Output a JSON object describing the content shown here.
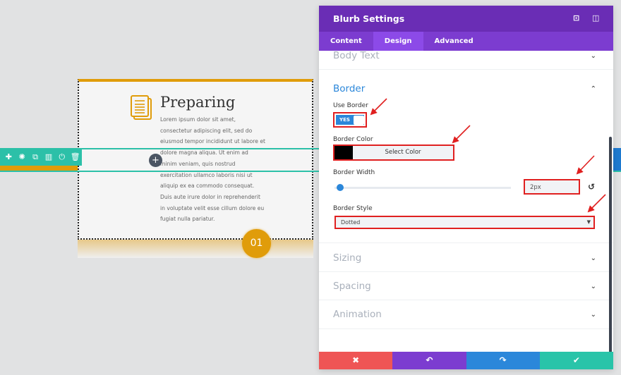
{
  "canvas": {
    "module_title": "Preparing",
    "module_body": "Lorem ipsum dolor sit amet, consectetur adipiscing elit, sed do eiusmod tempor incididunt ut labore et dolore magna aliqua. Ut enim ad minim veniam, quis nostrud exercitation ullamco laboris nisi ut aliquip ex ea commodo consequat. Duis aute irure dolor in reprehenderit in voluptate velit esse cillum dolore eu fugiat nulla pariatur.",
    "step_number": "01",
    "add_symbol": "+",
    "row_toolbar_icons": [
      "move-icon",
      "gear-icon",
      "duplicate-icon",
      "columns-icon",
      "save-icon",
      "trash-icon"
    ]
  },
  "panel": {
    "title": "Blurb Settings",
    "tabs": [
      {
        "label": "Content"
      },
      {
        "label": "Design"
      },
      {
        "label": "Advanced"
      }
    ],
    "active_tab": "Design",
    "sections": {
      "body_text": "Body Text",
      "border": "Border",
      "sizing": "Sizing",
      "spacing": "Spacing",
      "animation": "Animation"
    },
    "border": {
      "use_border_label": "Use Border",
      "use_border_value": "YES",
      "border_color_label": "Border Color",
      "border_color_value": "#000000",
      "select_color_label": "Select Color",
      "border_width_label": "Border Width",
      "border_width_value": "2px",
      "border_width_slider": 2,
      "border_style_label": "Border Style",
      "border_style_value": "Dotted"
    },
    "footer_buttons": [
      "close",
      "undo",
      "redo",
      "save"
    ]
  },
  "colors": {
    "purple": "#6a2db5",
    "accent_blue": "#2b87da",
    "orange": "#e09c0a",
    "teal": "#2cc0a8",
    "highlight_red": "#e02020"
  }
}
